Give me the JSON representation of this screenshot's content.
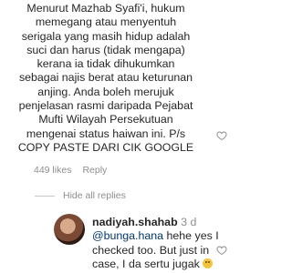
{
  "comment": {
    "lines": [
      "Menurut Mazhab Syafi'i, hukum",
      "memegang atau menyentuh",
      "serigala yang masih hidup adalah",
      "suci dan harus (tidak mengapa)",
      "kerana ia tidak dihukumkan",
      "sebagai najis berat atau keturunan",
      "anjing. Anda boleh merujuk",
      "penjelasan rasmi daripada Pejabat",
      "Mufti Wilayah Persekutuan",
      "mengenai status haiwan ini. P/s",
      "COPY PASTE DARI CIK GOOGLE"
    ],
    "likes": "449 likes",
    "reply_label": "Reply",
    "like_icon": "heart-outline-icon"
  },
  "thread": {
    "hide_replies_label": "Hide all replies"
  },
  "reply": {
    "username": "nadiyah.shahab",
    "time": "3 d",
    "mention": "@bunga.hana",
    "text_line1_suffix": " hehe yes I",
    "text_line2": "checked too. But just in",
    "text_line3": "case, I da sertu jugak ",
    "emoji": "grinning-face-emoji",
    "like_icon": "heart-outline-icon"
  }
}
